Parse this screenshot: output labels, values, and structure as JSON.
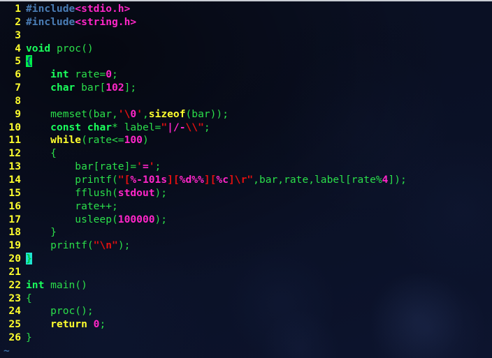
{
  "window": {
    "kind": "terminal-code-editor",
    "top_border_color": "#c9cdd4",
    "background_color": "#0a1025"
  },
  "colors": {
    "line_number": "#ffff2e",
    "preprocessor": "#4a7db5",
    "header_name": "#ff26c8",
    "keyword_type": "#1aff5c",
    "keyword_control": "#ffff2e",
    "identifier": "#2bde4a",
    "number": "#ff26c8",
    "string": "#e01010",
    "format_spec": "#ff26c8",
    "brace_match_bg": "#00ee4a",
    "cursor_bg": "#1fe3d0",
    "tilde_marker": "#3b6ea5"
  },
  "editor": {
    "tilde_marker": "~",
    "lines": [
      {
        "n": "1",
        "tokens": [
          {
            "t": "#include",
            "c": "pp"
          },
          {
            "t": "<stdio.h>",
            "c": "hdr"
          }
        ]
      },
      {
        "n": "2",
        "tokens": [
          {
            "t": "#include",
            "c": "pp"
          },
          {
            "t": "<string.h>",
            "c": "hdr"
          }
        ]
      },
      {
        "n": "3",
        "tokens": []
      },
      {
        "n": "4",
        "tokens": [
          {
            "t": "void",
            "c": "kw"
          },
          {
            "t": " proc()",
            "c": "plain"
          }
        ]
      },
      {
        "n": "5",
        "tokens": [
          {
            "t": "{",
            "c": "hl-brace"
          }
        ]
      },
      {
        "n": "6",
        "tokens": [
          {
            "t": "    ",
            "c": "plain"
          },
          {
            "t": "int",
            "c": "kw"
          },
          {
            "t": " rate=",
            "c": "plain"
          },
          {
            "t": "0",
            "c": "num"
          },
          {
            "t": ";",
            "c": "plain"
          }
        ]
      },
      {
        "n": "7",
        "tokens": [
          {
            "t": "    ",
            "c": "plain"
          },
          {
            "t": "char",
            "c": "kw"
          },
          {
            "t": " bar[",
            "c": "plain"
          },
          {
            "t": "102",
            "c": "num"
          },
          {
            "t": "];",
            "c": "plain"
          }
        ]
      },
      {
        "n": "8",
        "tokens": []
      },
      {
        "n": "9",
        "tokens": [
          {
            "t": "    memset(bar,",
            "c": "plain"
          },
          {
            "t": "'",
            "c": "str"
          },
          {
            "t": "\\",
            "c": "esc"
          },
          {
            "t": "0",
            "c": "chr"
          },
          {
            "t": "'",
            "c": "str"
          },
          {
            "t": ",",
            "c": "plain"
          },
          {
            "t": "sizeof",
            "c": "kw2"
          },
          {
            "t": "(bar));",
            "c": "plain"
          }
        ]
      },
      {
        "n": "10",
        "tokens": [
          {
            "t": "    ",
            "c": "plain"
          },
          {
            "t": "const",
            "c": "kw"
          },
          {
            "t": " ",
            "c": "plain"
          },
          {
            "t": "char",
            "c": "kw"
          },
          {
            "t": "* label=",
            "c": "plain"
          },
          {
            "t": "\"",
            "c": "str"
          },
          {
            "t": "|/-",
            "c": "fmt"
          },
          {
            "t": "\\\\",
            "c": "esc"
          },
          {
            "t": "\"",
            "c": "str"
          },
          {
            "t": ";",
            "c": "plain"
          }
        ]
      },
      {
        "n": "11",
        "tokens": [
          {
            "t": "    ",
            "c": "plain"
          },
          {
            "t": "while",
            "c": "kw2"
          },
          {
            "t": "(rate<=",
            "c": "plain"
          },
          {
            "t": "100",
            "c": "num"
          },
          {
            "t": ")",
            "c": "plain"
          }
        ]
      },
      {
        "n": "12",
        "tokens": [
          {
            "t": "    {",
            "c": "plain"
          }
        ]
      },
      {
        "n": "13",
        "tokens": [
          {
            "t": "        bar[rate]=",
            "c": "plain"
          },
          {
            "t": "'",
            "c": "str"
          },
          {
            "t": "=",
            "c": "chr"
          },
          {
            "t": "'",
            "c": "str"
          },
          {
            "t": ";",
            "c": "plain"
          }
        ]
      },
      {
        "n": "14",
        "tokens": [
          {
            "t": "        printf(",
            "c": "plain"
          },
          {
            "t": "\"[",
            "c": "str"
          },
          {
            "t": "%-101s",
            "c": "fmt"
          },
          {
            "t": "][",
            "c": "str"
          },
          {
            "t": "%d%%",
            "c": "fmt"
          },
          {
            "t": "][",
            "c": "str"
          },
          {
            "t": "%c",
            "c": "fmt"
          },
          {
            "t": "]",
            "c": "str"
          },
          {
            "t": "\\r",
            "c": "esc"
          },
          {
            "t": "\"",
            "c": "str"
          },
          {
            "t": ",bar,rate,label[rate%",
            "c": "plain"
          },
          {
            "t": "4",
            "c": "num"
          },
          {
            "t": "]);",
            "c": "plain"
          }
        ]
      },
      {
        "n": "15",
        "tokens": [
          {
            "t": "        fflush(",
            "c": "plain"
          },
          {
            "t": "stdout",
            "c": "ident"
          },
          {
            "t": ");",
            "c": "plain"
          }
        ]
      },
      {
        "n": "16",
        "tokens": [
          {
            "t": "        rate++;",
            "c": "plain"
          }
        ]
      },
      {
        "n": "17",
        "tokens": [
          {
            "t": "        usleep(",
            "c": "plain"
          },
          {
            "t": "100000",
            "c": "num"
          },
          {
            "t": ");",
            "c": "plain"
          }
        ]
      },
      {
        "n": "18",
        "tokens": [
          {
            "t": "    }",
            "c": "plain"
          }
        ]
      },
      {
        "n": "19",
        "tokens": [
          {
            "t": "    printf(",
            "c": "plain"
          },
          {
            "t": "\"",
            "c": "str"
          },
          {
            "t": "\\n",
            "c": "esc"
          },
          {
            "t": "\"",
            "c": "str"
          },
          {
            "t": ");",
            "c": "plain"
          }
        ]
      },
      {
        "n": "20",
        "tokens": [
          {
            "t": "}",
            "c": "hl-cursor"
          }
        ]
      },
      {
        "n": "21",
        "tokens": []
      },
      {
        "n": "22",
        "tokens": [
          {
            "t": "int",
            "c": "kw"
          },
          {
            "t": " main()",
            "c": "plain"
          }
        ]
      },
      {
        "n": "23",
        "tokens": [
          {
            "t": "{",
            "c": "plain"
          }
        ]
      },
      {
        "n": "24",
        "tokens": [
          {
            "t": "    proc();",
            "c": "plain"
          }
        ]
      },
      {
        "n": "25",
        "tokens": [
          {
            "t": "    ",
            "c": "plain"
          },
          {
            "t": "return",
            "c": "kw2"
          },
          {
            "t": " ",
            "c": "plain"
          },
          {
            "t": "0",
            "c": "num"
          },
          {
            "t": ";",
            "c": "plain"
          }
        ]
      },
      {
        "n": "26",
        "tokens": [
          {
            "t": "}",
            "c": "plain"
          }
        ]
      }
    ]
  }
}
